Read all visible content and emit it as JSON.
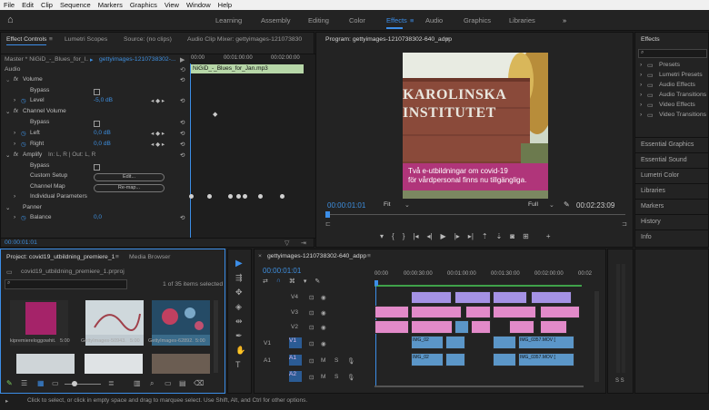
{
  "menu": [
    "File",
    "Edit",
    "Clip",
    "Sequence",
    "Markers",
    "Graphics",
    "View",
    "Window",
    "Help"
  ],
  "workspaces": [
    "Learning",
    "Assembly",
    "Editing",
    "Color",
    "Effects",
    "Audio",
    "Graphics",
    "Libraries"
  ],
  "active_workspace": "Effects",
  "effect_controls": {
    "tabs": [
      "Effect Controls",
      "Lumetri Scopes",
      "Source: (no clips)",
      "Audio Clip Mixer: gettyimages-121073830"
    ],
    "master": "Master * NiGiD_-_Blues_for_l...",
    "sequence_clip": "gettyimages-1210738302-...",
    "clip_name": "NiGiD_-_Blues_for_Jan.mp3",
    "ruler": [
      "00:00",
      "00:01:00:00",
      "00:02:00:00"
    ],
    "audio_header": "Audio",
    "volume": "Volume",
    "bypass": "Bypass",
    "level": "Level",
    "level_value": "-5,0 dB",
    "channel_volume": "Channel Volume",
    "left": "Left",
    "left_value": "0,0 dB",
    "right": "Right",
    "right_value": "0,0 dB",
    "amplify": "Amplify",
    "amplify_sub": "In: L, R | Out: L, R",
    "custom_setup": "Custom Setup",
    "edit_btn": "Edit...",
    "channel_map": "Channel Map",
    "remap_btn": "Re-map...",
    "individual_params": "Individual Parameters",
    "panner": "Panner",
    "balance": "Balance",
    "balance_value": "0,0",
    "timecode": "00:00:01:01"
  },
  "program": {
    "title": "Program: gettyimages-1210738302-640_adpp",
    "sign_line1": "KAROLINSKA",
    "sign_line2": "INSTITUTET",
    "caption_line1": "Två e-utbildningar om covid-19",
    "caption_line2": "för vårdpersonal finns nu tillgängliga.",
    "timecode": "00:00:01:01",
    "fit": "Fit",
    "quality": "Full",
    "duration": "00:02:23:09"
  },
  "effects_panel": {
    "title": "Effects",
    "items": [
      "Presets",
      "Lumetri Presets",
      "Audio Effects",
      "Audio Transitions",
      "Video Effects",
      "Video Transitions"
    ],
    "sections": [
      "Essential Graphics",
      "Essential Sound",
      "Lumetri Color",
      "Libraries",
      "Markers",
      "History",
      "Info"
    ]
  },
  "project": {
    "tabs": [
      "Project: covid19_utbildning_premiere_1",
      "Media Browser"
    ],
    "file": "covid19_utbildning_premiere_1.prproj",
    "count": "1 of 35 items selected",
    "thumbs": [
      {
        "name": "kipremiereloggowhit...",
        "dur": "5:00"
      },
      {
        "name": "GettyImages-50943...",
        "dur": "5:00"
      },
      {
        "name": "GettyImages-62892...",
        "dur": "5:00"
      }
    ]
  },
  "timeline": {
    "title": "gettyimages-1210738302-640_adpp",
    "timecode": "00:00:01:01",
    "ruler": [
      "00:00",
      "00:00:30:00",
      "00:01:00:00",
      "00:01:30:00",
      "00:02:00:00",
      "00:02"
    ],
    "tracks": [
      "V4",
      "V3",
      "V2",
      "V1",
      "A1",
      "A2"
    ],
    "clip_labels": [
      "IMG_02",
      "IMG_0357.MOV [",
      "IMG_02",
      "IMG_0357.MOV ["
    ],
    "meter": "S S"
  },
  "status": "Click to select, or click in empty space and drag to marquee select. Use Shift, Alt, and Ctrl for other options.",
  "colors": {
    "accent": "#3c8ee8",
    "pink": "#e28ac9",
    "violet": "#a592e5",
    "audio": "#5b96c8",
    "caption": "#b0357a"
  }
}
